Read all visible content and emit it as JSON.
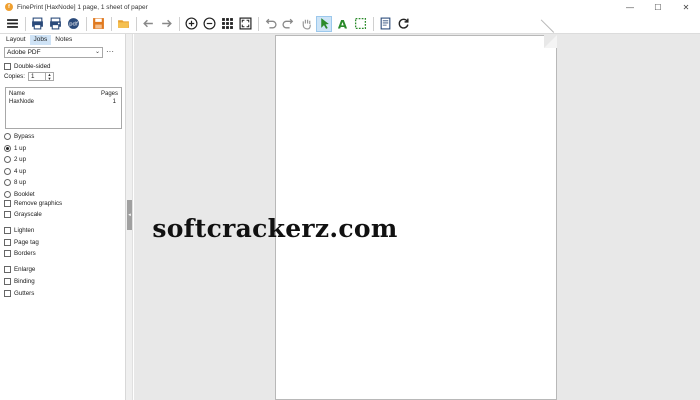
{
  "window": {
    "title": "FinePrint [HaxNode] 1 page, 1 sheet of paper",
    "controls": {
      "minimize": "—",
      "maximize": "☐",
      "close": "✕"
    }
  },
  "toolbar": {
    "icons": [
      "menu-icon",
      "print-icon",
      "printer-icon",
      "pdf-icon",
      "save-icon",
      "open-folder-icon",
      "back-arrow-icon",
      "forward-arrow-icon",
      "zoom-in-icon",
      "zoom-out-icon",
      "grid-icon",
      "fit-page-icon",
      "undo-icon",
      "redo-icon",
      "hand-icon",
      "select-arrow-icon",
      "text-tool-icon",
      "select-rect-icon",
      "letterhead-icon",
      "refresh-icon"
    ],
    "active": "select-arrow-icon"
  },
  "leftpanel": {
    "tabs": [
      "Layout",
      "Jobs",
      "Notes"
    ],
    "printer": "Adobe PDF",
    "more_label": "···",
    "double_sided": "Double-sided",
    "copies_label": "Copies:",
    "copies_value": "1",
    "joblist": {
      "headers": [
        "Name",
        "Pages"
      ],
      "rows": [
        {
          "name": "HaxNode",
          "pages": "1"
        }
      ]
    },
    "layout_options": [
      {
        "label": "Bypass",
        "selected": false
      },
      {
        "label": "1 up",
        "selected": true
      },
      {
        "label": "2 up",
        "selected": false
      },
      {
        "label": "4 up",
        "selected": false
      },
      {
        "label": "8 up",
        "selected": false
      },
      {
        "label": "Booklet",
        "selected": false
      }
    ],
    "checkboxes_1": [
      "Remove graphics",
      "Grayscale"
    ],
    "checkboxes_2": [
      "Lighten",
      "Page tag",
      "Borders"
    ],
    "checkboxes_3": [
      "Enlarge",
      "Binding",
      "Gutters"
    ]
  },
  "canvas": {
    "watermark": "softcrackerz.com"
  },
  "colors": {
    "accent": "#cfe3f6",
    "app_icon": "#f0a030",
    "canvas_bg": "#e8e8e8"
  }
}
